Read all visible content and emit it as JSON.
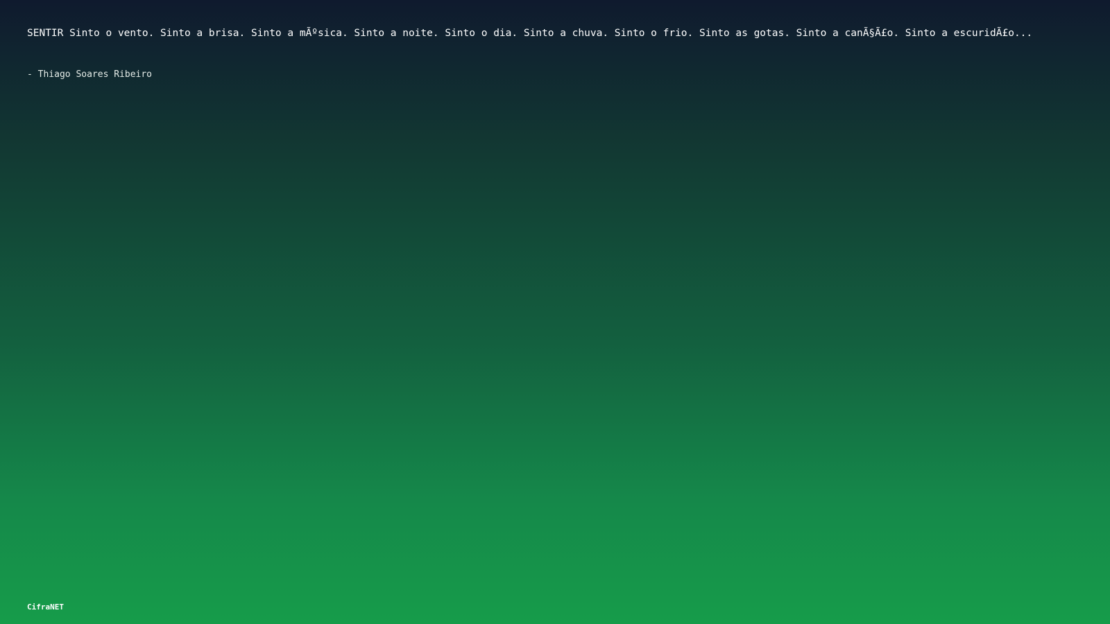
{
  "quote": {
    "text": "SENTIR Sinto o vento. Sinto a brisa. Sinto a mÃºsica. Sinto a noite. Sinto o dia. Sinto a chuva. Sinto o frio. Sinto as gotas. Sinto a canÃ§Ã£o. Sinto a escuridÃ£o...",
    "author": "- Thiago Soares Ribeiro"
  },
  "footer": {
    "brand": "CifraNET"
  },
  "colors": {
    "background_top": "#0f1a2e",
    "background_bottom": "#169c4a",
    "text": "#ffffff"
  }
}
